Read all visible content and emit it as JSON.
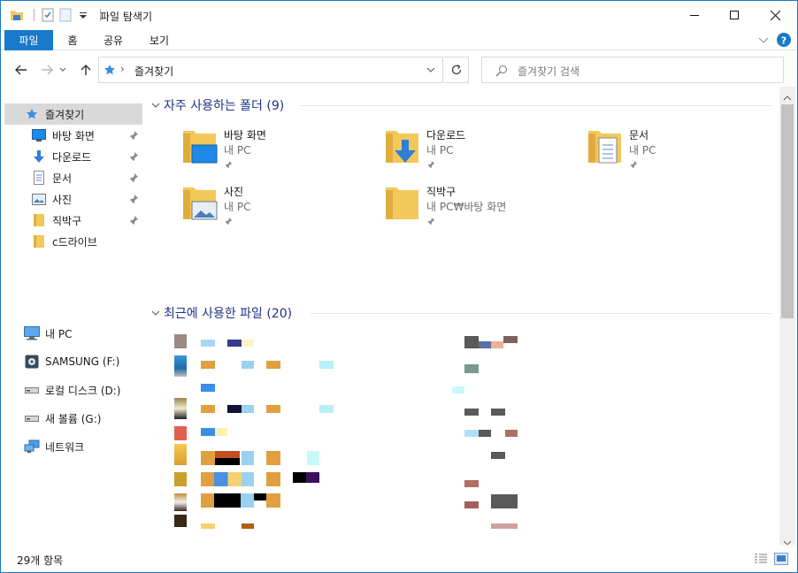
{
  "window": {
    "title": "파일 탐색기"
  },
  "ribbon": {
    "tabs": [
      "파일",
      "홈",
      "공유",
      "보기"
    ]
  },
  "address": {
    "path": "즐겨찾기",
    "separator": "›"
  },
  "search": {
    "placeholder": "즐겨찾기 검색"
  },
  "nav": {
    "quick_access": [
      {
        "label": "즐겨찾기",
        "icon": "star-icon"
      },
      {
        "label": "바탕 화면",
        "icon": "desktop-icon"
      },
      {
        "label": "다운로드",
        "icon": "download-icon"
      },
      {
        "label": "문서",
        "icon": "document-icon"
      },
      {
        "label": "사진",
        "icon": "picture-icon"
      },
      {
        "label": "직박구",
        "icon": "folder-icon"
      },
      {
        "label": "c드라이브",
        "icon": "folder-icon"
      }
    ],
    "devices": [
      {
        "label": "내 PC",
        "icon": "pc-icon"
      },
      {
        "label": "SAMSUNG (F:)",
        "icon": "usb-drive-icon"
      },
      {
        "label": "로컬 디스크 (D:)",
        "icon": "drive-icon"
      },
      {
        "label": "새 볼륨 (G:)",
        "icon": "drive-icon"
      },
      {
        "label": "네트워크",
        "icon": "network-icon"
      }
    ]
  },
  "frequent": {
    "header": "자주 사용하는 폴더 (9)",
    "folders": [
      {
        "name": "바탕 화면",
        "location": "내 PC"
      },
      {
        "name": "다운로드",
        "location": "내 PC"
      },
      {
        "name": "문서",
        "location": "내 PC"
      },
      {
        "name": "사진",
        "location": "내 PC"
      },
      {
        "name": "직박구",
        "location": "내 PC₩바탕 화면"
      }
    ]
  },
  "recent": {
    "header": "최근에 사용한 파일 (20)"
  },
  "status": {
    "item_count": "29개 항목"
  },
  "colors": {
    "accent": "#1979ca",
    "header": "#1e3287",
    "folder": "#f3c85a"
  }
}
